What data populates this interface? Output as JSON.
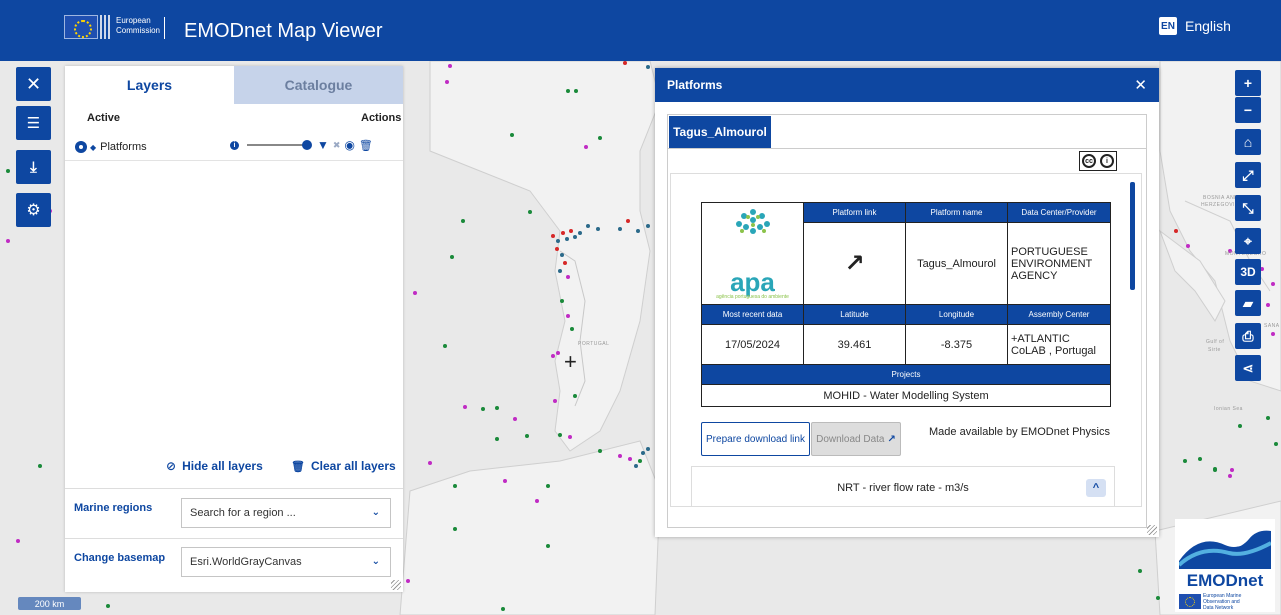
{
  "header": {
    "ec_line1": "European",
    "ec_line2": "Commission",
    "app_title": "EMODnet Map Viewer",
    "lang_code": "EN",
    "lang_label": "English"
  },
  "left_toolbar": {
    "icons": [
      "close-icon",
      "layers-list-icon",
      "download-icon",
      "settings-icon"
    ]
  },
  "layers_panel": {
    "tabs": [
      "Layers",
      "Catalogue"
    ],
    "active_header": "Active",
    "actions_header": "Actions",
    "layer_name": "Platforms",
    "opacity": 1.0,
    "hide_all": "Hide all layers",
    "clear_all": "Clear all layers",
    "marine_regions_label": "Marine regions",
    "marine_regions_placeholder": "Search for a region ...",
    "basemap_label": "Change basemap",
    "basemap_value": "Esri.WorldGrayCanvas"
  },
  "popup": {
    "title": "Platforms",
    "tab": "Tagus_Almourol",
    "apa_text": "apa",
    "apa_sub": "agência portuguesa do ambiente",
    "headers_row1": [
      "Platform link",
      "Platform name",
      "Data Center/Provider"
    ],
    "platform_name": "Tagus_Almourol",
    "provider": "PORTUGUESE ENVIRONMENT AGENCY",
    "headers_row2": [
      "Most recent data",
      "Latitude",
      "Longitude",
      "Assembly Center"
    ],
    "recent_date": "17/05/2024",
    "latitude": "39.461",
    "longitude": "-8.375",
    "assembly_center": "+ATLANTIC CoLAB , Portugal",
    "projects_header": "Projects",
    "project": "MOHID - Water Modelling System",
    "prepare_btn": "Prepare download link",
    "download_btn": "Download Data",
    "made_by": "Made available by EMODnet Physics",
    "nrt": "NRT - river flow rate - m3/s"
  },
  "right_toolbar": {
    "icons": [
      "zoom-in-icon",
      "zoom-out-icon",
      "home-icon",
      "fullscreen-icon",
      "collapse-icon",
      "locate-icon",
      "3d-toggle",
      "measure-icon",
      "print-icon",
      "share-icon"
    ],
    "threed_label": "3D"
  },
  "map": {
    "scale": "200 km",
    "country_labels": [
      "PORTUGAL",
      "BOSNIA AND",
      "HERZEGOVINA",
      "MONTENEGRO",
      "Gulf of",
      "Sirte",
      "Ionian Sea",
      "SANA"
    ]
  },
  "emodnet_logo": {
    "name": "EMODnet",
    "sub1": "European Marine",
    "sub2": "Observation and",
    "sub3": "Data Network"
  }
}
